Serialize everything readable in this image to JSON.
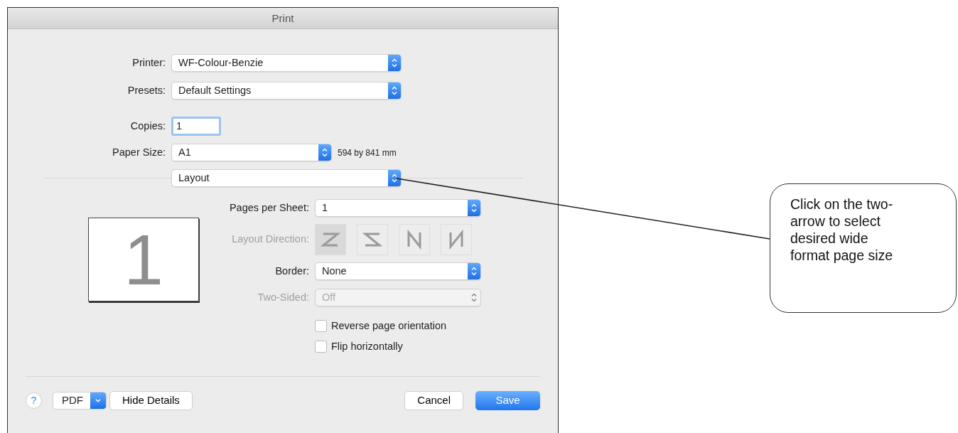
{
  "window": {
    "title": "Print"
  },
  "fields": [
    {
      "label": "Printer:",
      "kind": "popup",
      "value": "WF-Colour-Benzie"
    },
    {
      "label": "Presets:",
      "kind": "popup",
      "value": "Default Settings"
    },
    {
      "label": "Copies:",
      "kind": "text",
      "value": "1"
    },
    {
      "label": "Paper Size:",
      "kind": "popup",
      "value": "A1",
      "note": "594 by 841 mm"
    }
  ],
  "section_popup": {
    "value": "Layout"
  },
  "preview": {
    "page_number": "1"
  },
  "layout_options": [
    {
      "label": "Pages per Sheet:",
      "kind": "popup",
      "value": "1",
      "disabled": false
    },
    {
      "label": "Layout Direction:",
      "kind": "direction",
      "disabled": true,
      "options": [
        {
          "kind": "z",
          "selected": true
        },
        {
          "kind": "s",
          "selected": false
        },
        {
          "kind": "n-reverse",
          "selected": false
        },
        {
          "kind": "n",
          "selected": false
        }
      ]
    },
    {
      "label": "Border:",
      "kind": "popup",
      "value": "None",
      "disabled": false
    },
    {
      "label": "Two-Sided:",
      "kind": "popup",
      "value": "Off",
      "disabled": true
    }
  ],
  "checkboxes": [
    {
      "label": "Reverse page orientation",
      "checked": false
    },
    {
      "label": "Flip horizontally",
      "checked": false
    }
  ],
  "footer": {
    "help": "?",
    "pdf": "PDF",
    "hide_details": "Hide Details",
    "cancel": "Cancel",
    "save": "Save"
  },
  "callout": {
    "text": "Click on the two-arrow to select desired wide format page size"
  }
}
